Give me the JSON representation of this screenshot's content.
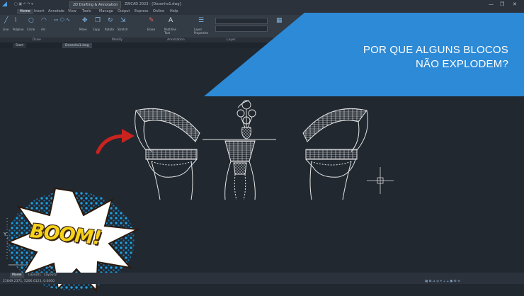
{
  "titlebar": {
    "app_icon": "app-logo-icon",
    "workspace": "2D Drafting & Annotation",
    "title": "ZWCAD 2023 - [Desenho1.dwg]",
    "window_controls": [
      "—",
      "❐",
      "✕"
    ]
  },
  "ribbon_tabs": [
    "Home",
    "Insert",
    "Annotate",
    "View",
    "Tools",
    "Manage",
    "Output",
    "Express",
    "Online",
    "Help"
  ],
  "ribbon": {
    "draw_tools": [
      "Line",
      "Polyline",
      "Circle",
      "Arc"
    ],
    "modify_tools": [
      "Move",
      "Copy",
      "Rotate",
      "Stretch",
      "Erase"
    ],
    "annotation_tools": [
      "Multiline Text"
    ],
    "layer_tools": [
      "Layer Properties"
    ]
  },
  "panel_labels": [
    "Draw",
    "Modify",
    "Annotation",
    "Layer",
    "Block",
    "Properties"
  ],
  "doc_tabs": [
    "Start",
    "Desenho1.dwg"
  ],
  "banner": {
    "line1": "POR QUE ALGUNS BLOCOS",
    "line2": "NÃO EXPLODEM?",
    "color": "#2d8ad6"
  },
  "boom": {
    "text": "BOOM!"
  },
  "statusbar": {
    "coords": "21849.2371, 5206.0123, 0.0000",
    "tabs": [
      "Model",
      "Layout1",
      "Layout2"
    ]
  },
  "axis": {
    "x_label": "X",
    "y_label": "Y"
  }
}
